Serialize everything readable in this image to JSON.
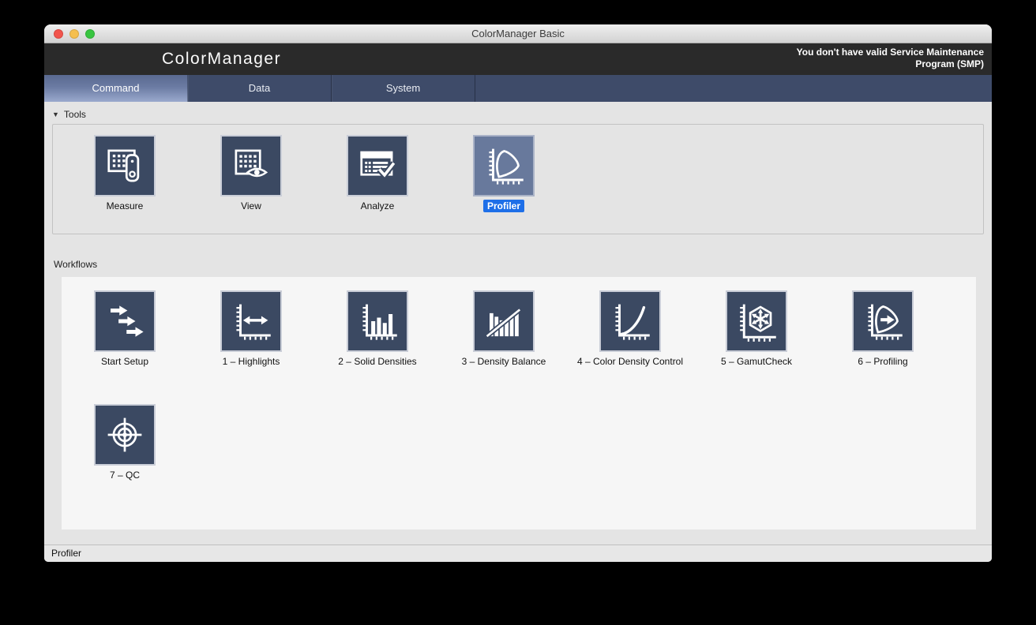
{
  "window": {
    "title": "ColorManager Basic"
  },
  "header": {
    "logo": "ColorManager",
    "warning_line1": "You don't have valid Service Maintenance",
    "warning_line2": "Program (SMP)"
  },
  "tabs": [
    {
      "label": "Command",
      "selected": true
    },
    {
      "label": "Data",
      "selected": false
    },
    {
      "label": "System",
      "selected": false
    }
  ],
  "tools": {
    "collapse_indicator": "▼",
    "section_label": "Tools",
    "items": [
      {
        "label": "Measure",
        "icon": "measure-icon",
        "selected": false
      },
      {
        "label": "View",
        "icon": "view-icon",
        "selected": false
      },
      {
        "label": "Analyze",
        "icon": "analyze-icon",
        "selected": false
      },
      {
        "label": "Profiler",
        "icon": "profiler-icon",
        "selected": true
      }
    ]
  },
  "workflows": {
    "section_label": "Workflows",
    "items": [
      {
        "label": "Start Setup",
        "icon": "start-setup-icon"
      },
      {
        "label": "1 – Highlights",
        "icon": "highlights-icon"
      },
      {
        "label": "2 – Solid Densities",
        "icon": "solid-densities-icon"
      },
      {
        "label": "3 – Density Balance",
        "icon": "density-balance-icon"
      },
      {
        "label": "4 – Color Density Control",
        "icon": "color-density-control-icon"
      },
      {
        "label": "5 – GamutCheck",
        "icon": "gamutcheck-icon"
      },
      {
        "label": "6 – Profiling",
        "icon": "profiling-icon"
      },
      {
        "label": "7 – QC",
        "icon": "qc-icon"
      }
    ]
  },
  "status_bar": {
    "text": "Profiler"
  },
  "colors": {
    "tile_navy": "#3b4962",
    "selection_blue": "#1e6fe8",
    "tab_bar": "#3e4b69",
    "brand_bar": "#2a2a2a"
  }
}
